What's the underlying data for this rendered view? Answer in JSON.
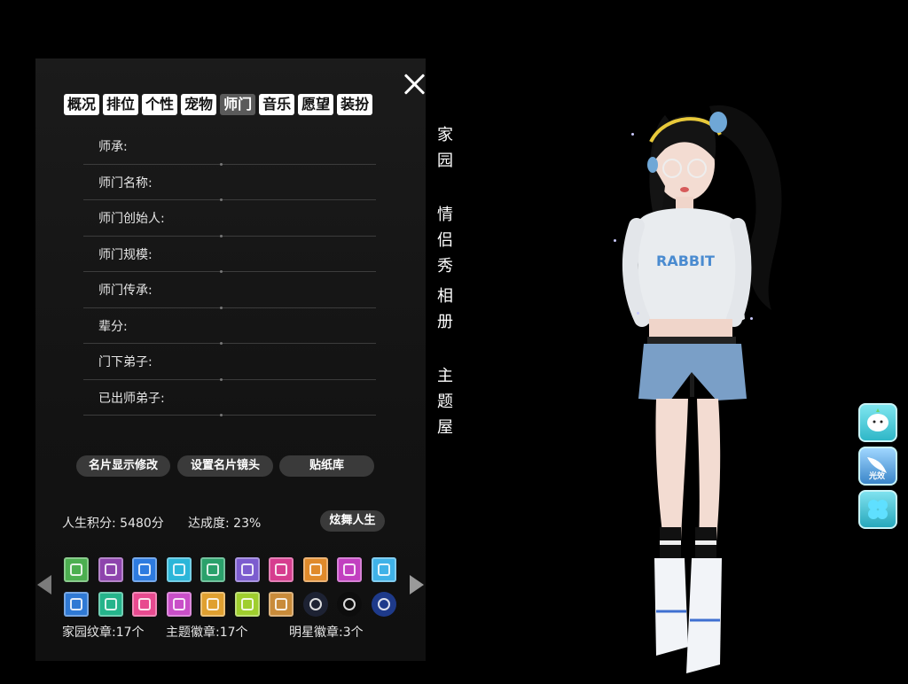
{
  "tabs": [
    "概况",
    "排位",
    "个性",
    "宠物",
    "师门",
    "音乐",
    "愿望",
    "装扮"
  ],
  "active_tab": 4,
  "fields": [
    "师承:",
    "师门名称:",
    "师门创始人:",
    "师门规模:",
    "师门传承:",
    "辈分:",
    "门下弟子:",
    "已出师弟子:"
  ],
  "buttons": {
    "card_display": "名片显示修改",
    "card_camera": "设置名片镜头",
    "sticker_lib": "贴纸库",
    "dance_life": "炫舞人生"
  },
  "stats": {
    "score_label": "人生积分:",
    "score_value": "5480分",
    "progress_label": "达成度:",
    "progress_value": "23%"
  },
  "badge_colors": [
    "#4caf50",
    "#8e44ad",
    "#2d7be0",
    "#2bb6d9",
    "#2aa16b",
    "#7c5ccf",
    "#d63d8f",
    "#e08a2b",
    "#c23fc0",
    "#3fb2e8",
    "#2f79d4",
    "#25b48b",
    "#e84a8f",
    "#c94fc8",
    "#e0a030",
    "#9fce2e",
    "#c98b3a",
    "#1d2233",
    "#0d0d0d",
    "#1e3a8a"
  ],
  "badge_icons": [
    "badge-icon",
    "badge-icon",
    "badge-icon",
    "diamond-badge-icon",
    "badge-icon",
    "badge-icon",
    "badge-icon",
    "crab-badge-icon",
    "star-badge-icon",
    "cupcake-badge-icon",
    "badge-icon",
    "badge-icon",
    "paw-badge-icon",
    "badge-icon",
    "badge-icon",
    "eye-badge-icon",
    "crown-badge-icon",
    "red-blue-emblem-icon",
    "green-lantern-emblem-icon",
    "x-emblem-icon"
  ],
  "badge_counts": {
    "home": "家园纹章:17个",
    "theme": "主题徽章:17个",
    "star": "明星徽章:3个"
  },
  "side_nav": [
    {
      "label": "家园",
      "chars": [
        "家",
        "园"
      ]
    },
    {
      "label": "情侣秀",
      "chars": [
        "情",
        "侣",
        "秀"
      ]
    },
    {
      "label": "相册",
      "chars": [
        "相",
        "册"
      ]
    },
    {
      "label": "主题屋",
      "chars": [
        "主",
        "题",
        "屋"
      ]
    }
  ],
  "right_buttons": [
    {
      "icon": "cartoon-face-icon",
      "label": ""
    },
    {
      "icon": "wing-icon",
      "label": "光效"
    },
    {
      "icon": "clover-icon",
      "label": ""
    }
  ]
}
